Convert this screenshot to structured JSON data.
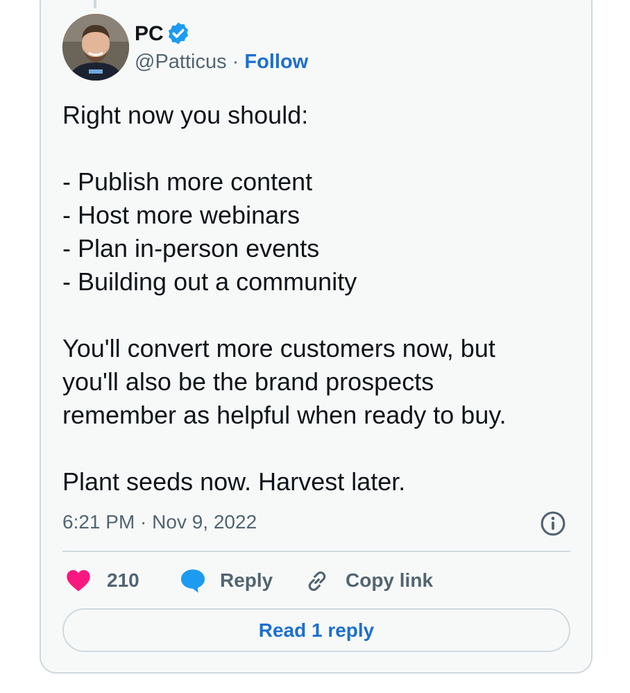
{
  "author": {
    "name": "PC",
    "handle": "@Patticus",
    "separator": "·",
    "follow_label": "Follow",
    "verified": true
  },
  "tweet": {
    "text": "Right now you should:\n\n- Publish more content\n- Host more webinars\n- Plan in-person events\n- Building out a community\n\nYou'll convert more customers now, but\nyou'll also be the brand prospects\nremember as helpful when ready to buy.\n\nPlant seeds now. Harvest later.",
    "timestamp": "6:21 PM · Nov 9, 2022"
  },
  "actions": {
    "likes_count": "210",
    "reply_label": "Reply",
    "copy_link_label": "Copy link"
  },
  "read_replies_label": "Read 1 reply",
  "icons": {
    "verified": "verified-badge-icon",
    "info": "info-icon",
    "like": "heart-icon",
    "reply": "speech-bubble-icon",
    "copy_link": "link-icon"
  },
  "colors": {
    "accent": "#1d6fd0",
    "verified": "#1d9bf0",
    "heart": "#f91880",
    "muted": "#536471",
    "border": "#cfd9de",
    "card_bg": "#f7f9f9"
  }
}
